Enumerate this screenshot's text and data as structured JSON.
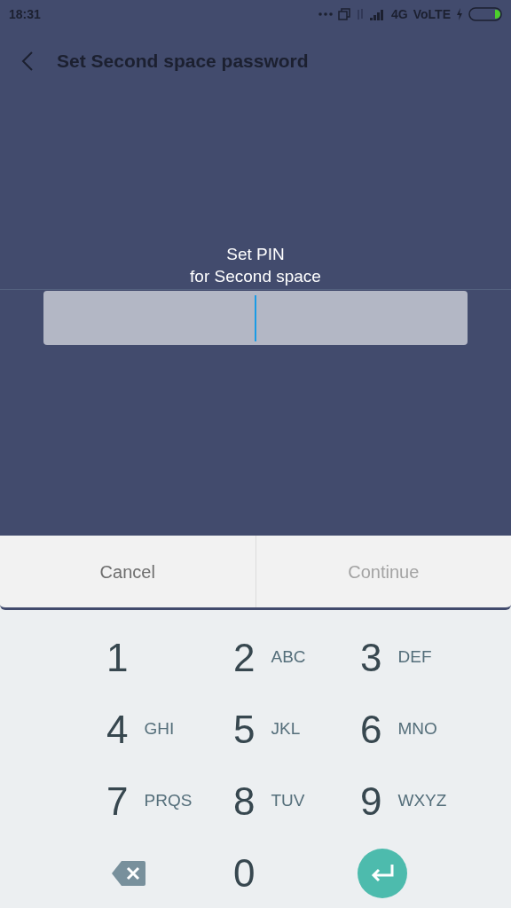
{
  "status_bar": {
    "time": "18:31",
    "network": "4G",
    "volte": "VoLTE"
  },
  "header": {
    "title": "Set Second space password"
  },
  "prompt": {
    "line_1": "Set PIN",
    "line_2": "for Second space"
  },
  "pin_field": {
    "focused": true
  },
  "buttons": [
    {
      "label": "Cancel",
      "disabled": false
    },
    {
      "label": "Continue",
      "disabled": true
    }
  ],
  "keypad": [
    {
      "kind": "digit",
      "digit": "1"
    },
    {
      "kind": "digit",
      "digit": "2",
      "letters": "ABC"
    },
    {
      "kind": "digit",
      "digit": "3",
      "letters": "DEF"
    },
    {
      "kind": "digit",
      "digit": "4",
      "letters": "GHI"
    },
    {
      "kind": "digit",
      "digit": "5",
      "letters": "JKL"
    },
    {
      "kind": "digit",
      "digit": "6",
      "letters": "MNO"
    },
    {
      "kind": "digit",
      "digit": "7",
      "letters": "PRQS"
    },
    {
      "kind": "digit",
      "digit": "8",
      "letters": "TUV"
    },
    {
      "kind": "digit",
      "digit": "9",
      "letters": "WXYZ"
    },
    {
      "kind": "backspace"
    },
    {
      "kind": "digit",
      "digit": "0"
    },
    {
      "kind": "enter"
    }
  ]
}
